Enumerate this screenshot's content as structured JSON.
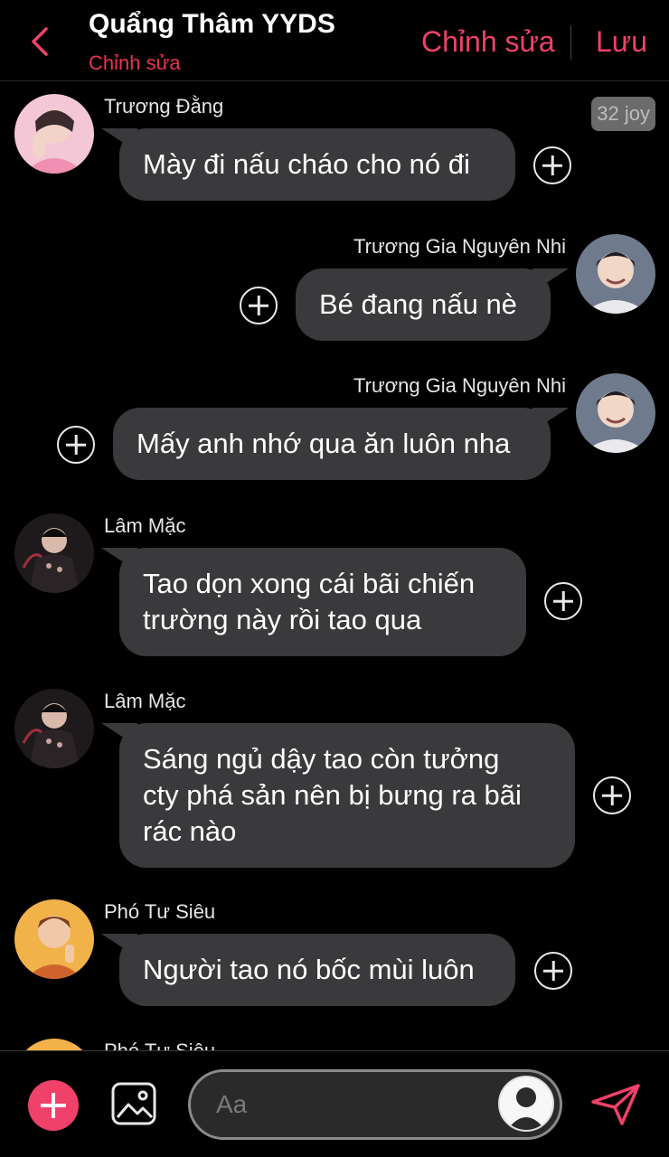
{
  "header": {
    "title": "Quẩng Thâm YYDS",
    "subtitle": "Chỉnh sửa",
    "edit_label": "Chỉnh sửa",
    "save_label": "Lưu"
  },
  "colors": {
    "accent": "#f0416a",
    "bubble": "#3a3a3c",
    "background": "#000000"
  },
  "messages": [
    {
      "sender": "Trương Đằng",
      "text": "Mày đi nấu cháo cho nó đi",
      "direction": "incoming",
      "badge": "32 joy"
    },
    {
      "sender": "Trương Gia Nguyên Nhi",
      "text": "Bé đang nấu nè",
      "direction": "outgoing"
    },
    {
      "sender": "Trương Gia Nguyên Nhi",
      "text": "Mấy anh nhớ qua ăn luôn nha",
      "direction": "outgoing"
    },
    {
      "sender": "Lâm Mặc",
      "line1": "Tao dọn xong cái bãi chiến",
      "line2": "trường này rồi tao qua",
      "direction": "incoming"
    },
    {
      "sender": "Lâm Mặc",
      "line1": "Sáng ngủ dậy tao còn tưởng",
      "line2": "cty phá sản nên bị bưng ra bãi",
      "line3": "rác nào",
      "direction": "incoming"
    },
    {
      "sender": "Phó Tư Siêu",
      "text": "Người tao nó bốc mùi luôn",
      "direction": "incoming"
    },
    {
      "sender": "Phó Tư Siêu",
      "direction": "incoming"
    }
  ],
  "composer": {
    "placeholder": "Aa"
  },
  "icons": {
    "back": "chevron-left-icon",
    "add": "plus-icon",
    "image": "image-icon",
    "send": "send-icon",
    "reaction": "plus-circle-icon"
  }
}
